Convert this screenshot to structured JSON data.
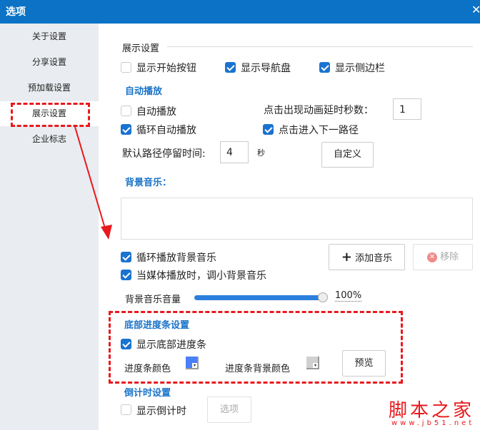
{
  "window": {
    "title": "选项",
    "close_glyph": "✕"
  },
  "sidebar": {
    "items": [
      {
        "label": "关于设置"
      },
      {
        "label": "分享设置"
      },
      {
        "label": "预加载设置"
      },
      {
        "label": "展示设置",
        "selected": true
      },
      {
        "label": "企业标志"
      }
    ]
  },
  "display": {
    "section_title": "展示设置",
    "show_start_button": {
      "label": "显示开始按钮",
      "checked": false
    },
    "show_nav": {
      "label": "显示导航盘",
      "checked": true
    },
    "show_sidebar": {
      "label": "显示侧边栏",
      "checked": true
    }
  },
  "autoplay": {
    "section_title": "自动播放",
    "autoplay": {
      "label": "自动播放",
      "checked": false
    },
    "loop": {
      "label": "循环自动播放",
      "checked": true
    },
    "delay_label": "点击出现动画延时秒数：",
    "delay_value": "1",
    "next_path": {
      "label": "点击进入下一路径",
      "checked": true
    },
    "stay_label": "默认路径停留时间:",
    "stay_value": "4",
    "stay_unit": "秒",
    "custom_button": "自定义"
  },
  "music": {
    "section_title": "背景音乐：",
    "loop": {
      "label": "循环播放背景音乐",
      "checked": true
    },
    "duck": {
      "label": "当媒体播放时，调小背景音乐",
      "checked": true
    },
    "add_button": "添加音乐",
    "remove_button": "移除",
    "volume_label": "背景音乐音量",
    "volume_value": "100%",
    "volume_fraction": 1.0
  },
  "progress": {
    "section_title": "底部进度条设置",
    "show": {
      "label": "显示底部进度条",
      "checked": true
    },
    "color_label": "进度条颜色",
    "color": "#4a7ff5",
    "bg_color_label": "进度条背景颜色",
    "bg_color": "#d0d0d0",
    "preview_button": "预览"
  },
  "countdown": {
    "section_title": "倒计时设置",
    "show": {
      "label": "显示倒计时",
      "checked": false
    },
    "options_button": "选项"
  },
  "watermark": {
    "text": "脚本之家",
    "url": "www.jb51.net"
  }
}
